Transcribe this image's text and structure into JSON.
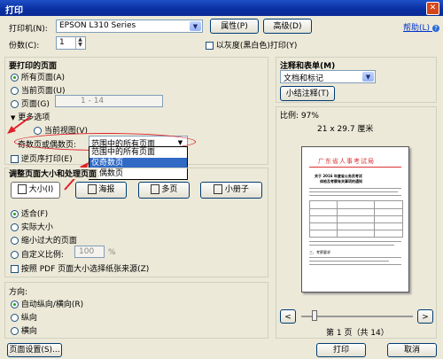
{
  "window": {
    "title": "打印",
    "close_glyph": "✕"
  },
  "printer": {
    "label": "打印机(N):",
    "name": "EPSON L310 Series",
    "properties_button": "属性(P)",
    "advanced_button": "高级(D)",
    "help_link": "帮助(L)"
  },
  "copies": {
    "label": "份数(C):",
    "value": "1",
    "grayscale_checkbox": "以灰度(黑白色)打印(Y)"
  },
  "pages_to_print": {
    "heading": "要打印的页面",
    "all_pages": "所有页面(A)",
    "current_page": "当前页面(U)",
    "pages": "页面(G)",
    "pages_range_placeholder": "1 - 14",
    "more_options": "更多选项",
    "current_view": "当前视图(V)",
    "odd_even_label": "奇数页或偶数页:",
    "odd_even_value": "范围中的所有页面",
    "dropdown_options": [
      "范围中的所有页面",
      "仅奇数页",
      "仅偶数页"
    ],
    "reverse_order": "逆页序打印(E)"
  },
  "page_sizing": {
    "heading": "调整页面大小和处理页面",
    "tabs": [
      "大小(I)",
      "海报",
      "多页",
      "小册子"
    ],
    "fit": "适合(F)",
    "actual_size": "实际大小",
    "shrink_oversized": "缩小过大的页面",
    "custom_scale": "自定义比例:",
    "custom_scale_value": "100",
    "percent": "%",
    "choose_paper_by_pdf": "按照 PDF 页面大小选择纸张来源(Z)"
  },
  "orientation": {
    "heading": "方向:",
    "auto": "自动纵向/横向(R)",
    "portrait": "纵向",
    "landscape": "横向"
  },
  "comments": {
    "heading": "注释和表单(M)",
    "value": "文档和标记",
    "summarize_button": "小结注释(T)"
  },
  "preview": {
    "scale": "比例: 97%",
    "paper_size": "21 x 29.7 厘米",
    "doc_heading": "广东省人事考试局",
    "doc_title_1": "关于 2016 年度省公务员考试",
    "doc_title_2": "体检及考察有关事项的通知",
    "doc_section": "三、考察要求",
    "page_indicator": "第 1 页（共 14）",
    "prev_glyph": "<",
    "next_glyph": ">"
  },
  "footer": {
    "page_setup_button": "页面设置(S)...",
    "print_button": "打印",
    "cancel_button": "取消"
  },
  "colors": {
    "title_bar": "#0a2fa0",
    "dialog_bg": "#ece9d8",
    "annotation_red": "#e0202a",
    "selection": "#316ac5"
  }
}
